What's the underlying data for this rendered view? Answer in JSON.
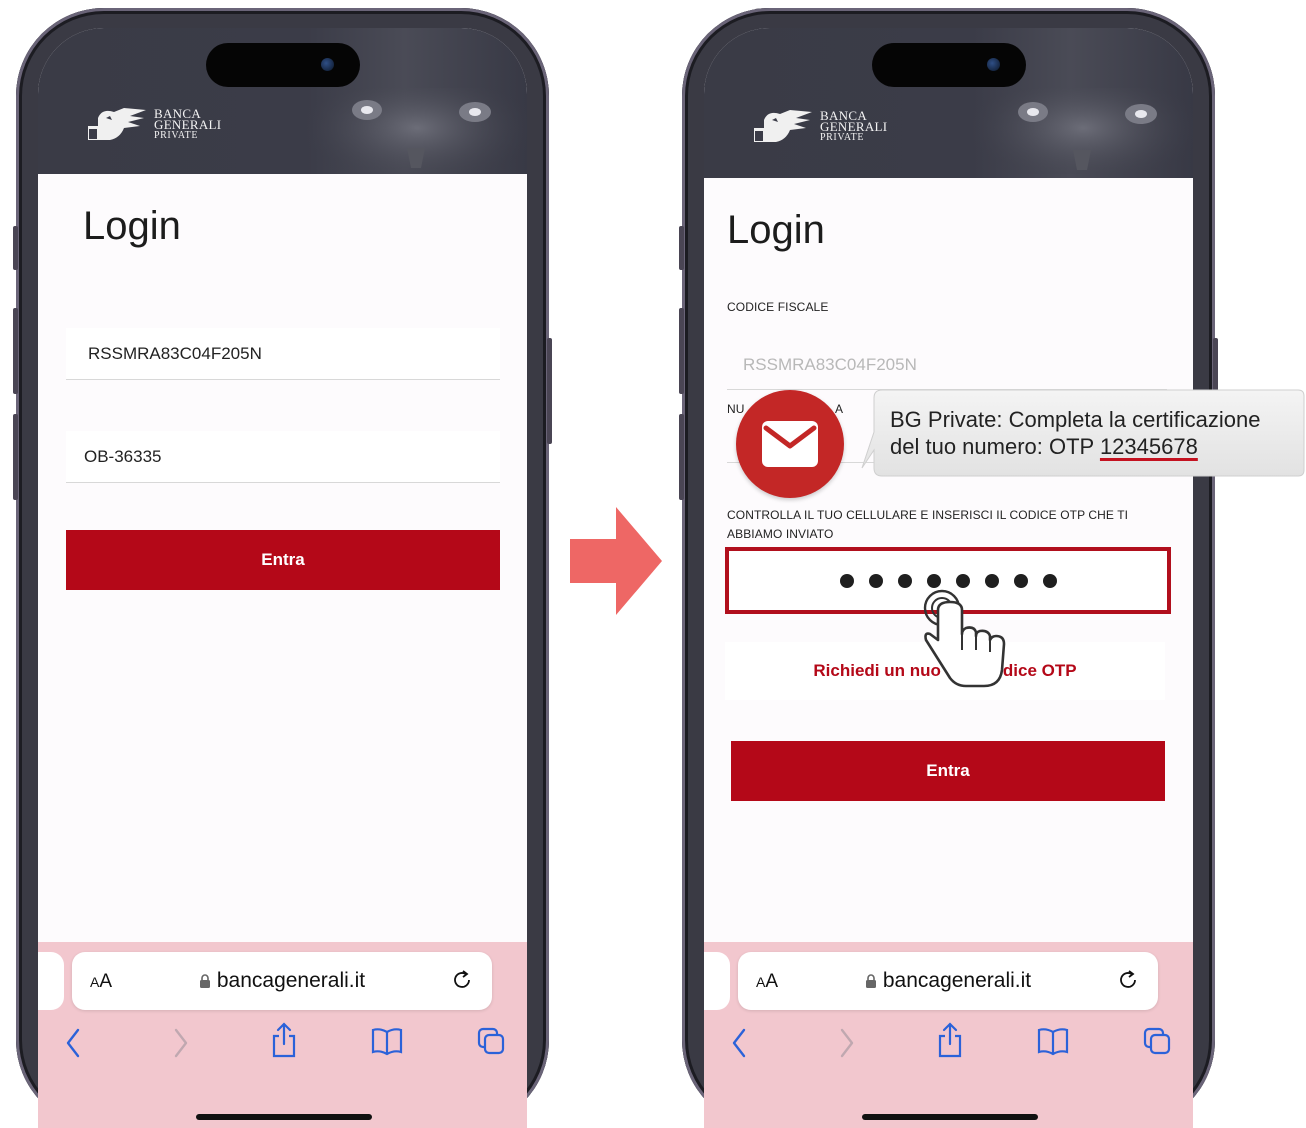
{
  "brand": {
    "line1": "BANCA",
    "line2": "GENERALI",
    "line3": "PRIVATE"
  },
  "left_screen": {
    "title": "Login",
    "fiscal_code_value": "RSSMRA83C04F205N",
    "user_field_value": "OB-36335",
    "submit_label": "Entra"
  },
  "right_screen": {
    "title": "Login",
    "fiscal_code_label": "CODICE FISCALE",
    "fiscal_code_value": "RSSMRA83C04F205N",
    "phone_label_visible_start": "NU",
    "phone_label_visible_end": "A",
    "otp_instruction": "CONTROLLA IL TUO CELLULARE E INSERISCI IL CODICE OTP CHE TI ABBIAMO INVIATO",
    "otp_dot_count": 8,
    "resend_label_part1": "Richiedi un nuo",
    "resend_label_part2": "dice OTP",
    "submit_label": "Entra"
  },
  "safari": {
    "text_size_label": "AA",
    "url": "bancagenerali.it"
  },
  "sms_notification": {
    "line1": "BG Private: Completa la certificazione",
    "line2_prefix": "del tuo numero: OTP ",
    "otp_code": "12345678"
  },
  "icons": {
    "arrow": "right-arrow-icon",
    "mail": "mail-icon",
    "hand": "tap-hand-icon",
    "lock": "lock-icon",
    "reload": "reload-icon",
    "back": "chevron-left-icon",
    "forward": "chevron-right-icon",
    "share": "share-icon",
    "bookmarks": "book-icon",
    "tabs": "tabs-icon"
  },
  "colors": {
    "accent_red": "#b40818",
    "header_dark": "#3b3c48",
    "safari_bar": "#f2c7ce",
    "arrow_red": "#ee6765",
    "mail_circle": "#c32726"
  }
}
